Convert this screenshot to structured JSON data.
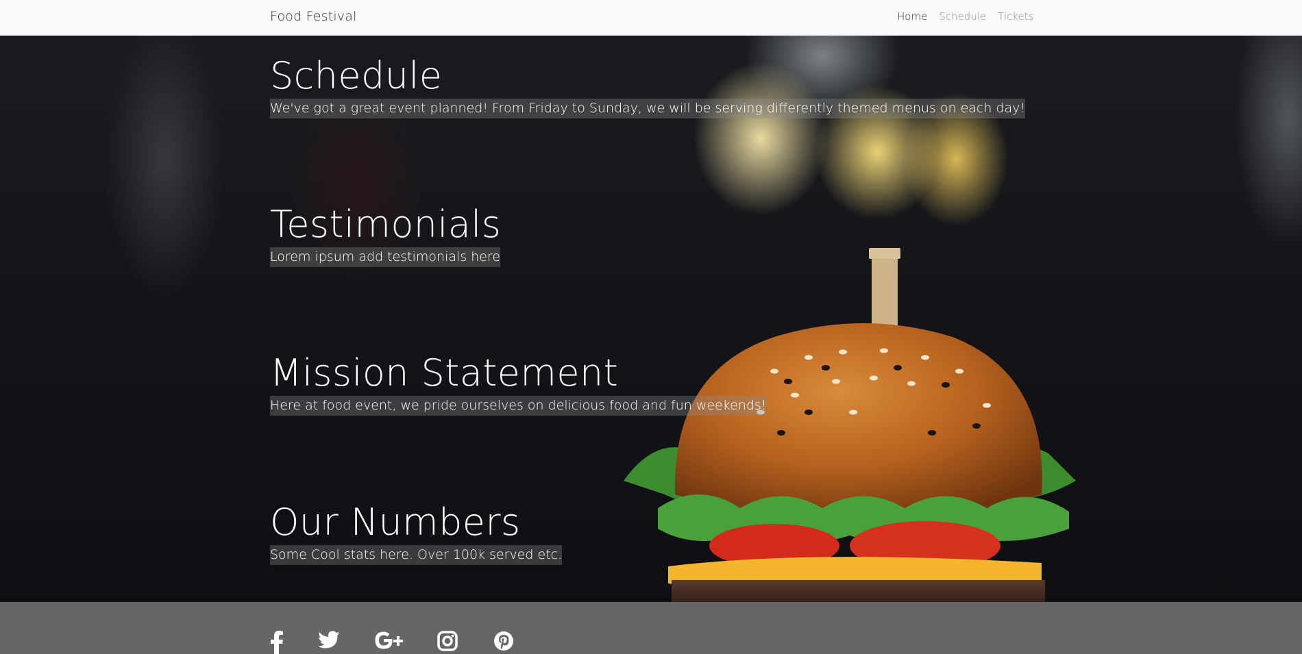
{
  "nav": {
    "brand": "Food Festival",
    "links": [
      {
        "label": "Home",
        "active": true
      },
      {
        "label": "Schedule",
        "active": false
      },
      {
        "label": "Tickets",
        "active": false
      }
    ]
  },
  "sections": [
    {
      "title": "Schedule",
      "text": "We've got a great event planned! From Friday to Sunday, we will be serving differently themed menus on each day!"
    },
    {
      "title": "Testimonials",
      "text": "Lorem ipsum add testimonials here"
    },
    {
      "title": "Mission Statement",
      "text": "Here at food event, we pride ourselves on delicious food and fun weekends!"
    },
    {
      "title": "Our Numbers",
      "text": "Some Cool stats here. Over 100k served etc."
    }
  ],
  "footer": {
    "social_icons": [
      "facebook-icon",
      "twitter-icon",
      "google-plus-icon",
      "instagram-icon",
      "pinterest-icon"
    ],
    "icon_color": "#ffffff",
    "background": "#666666"
  }
}
